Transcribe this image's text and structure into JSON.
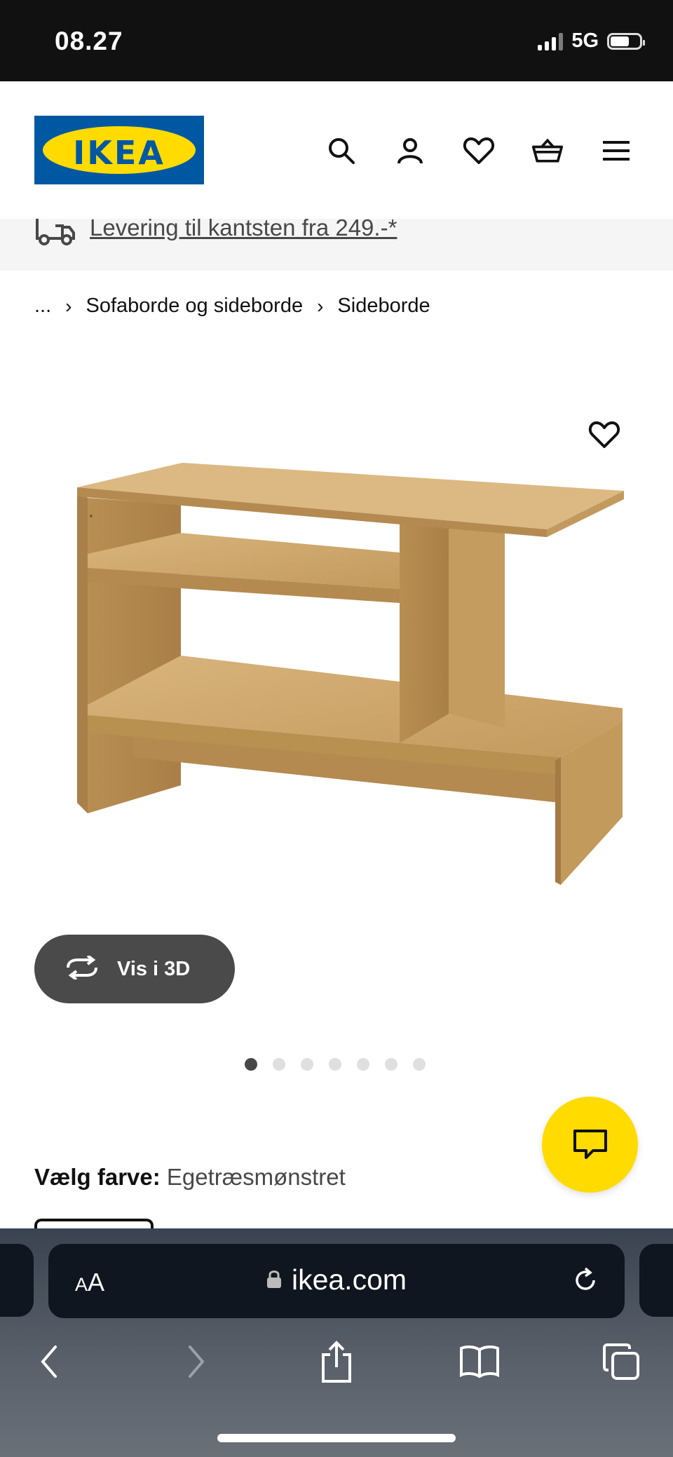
{
  "status_bar": {
    "time": "08.27",
    "network": "5G",
    "battery_level": 0.64
  },
  "header": {
    "logo_text": "IKEA",
    "icons": [
      "search-icon",
      "account-icon",
      "heart-icon",
      "basket-icon",
      "menu-icon"
    ],
    "brand_colors": {
      "blue": "#0058a3",
      "yellow": "#ffdb00"
    }
  },
  "delivery_banner": {
    "text": "Levering til kantsten fra 249.-*"
  },
  "breadcrumb": {
    "ellipsis": "...",
    "items": [
      "Sofaborde og sideborde",
      "Sideborde"
    ],
    "separator": "›"
  },
  "product": {
    "view3d_label": "Vis i 3D",
    "image_count": 7,
    "active_image": 1,
    "color_label": "Vælg farve:",
    "color_value": "Egetræsmønstret"
  },
  "browser": {
    "text_size_label": "AA",
    "url": "ikea.com"
  }
}
